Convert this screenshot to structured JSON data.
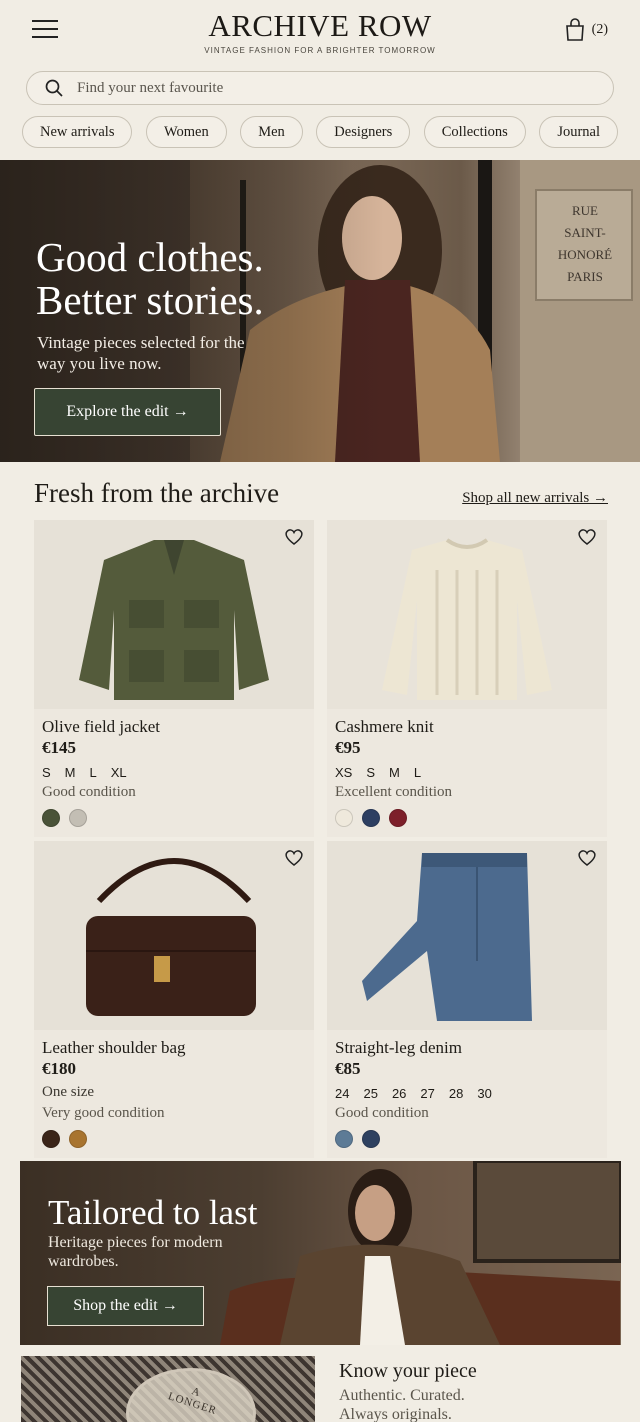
{
  "header": {
    "brand": "ARCHIVE ROW",
    "tagline": "VINTAGE FASHION FOR A BRIGHTER TOMORROW",
    "cart_count": "(2)",
    "icons": {
      "menu": "hamburger-menu-icon",
      "cart": "shopping-bag-icon"
    }
  },
  "search": {
    "placeholder": "Find your next favourite",
    "icon": "search-icon"
  },
  "nav": {
    "chips": [
      "New arrivals",
      "Women",
      "Men",
      "Designers",
      "Collections",
      "Journal"
    ]
  },
  "hero": {
    "title_line1": "Good clothes.",
    "title_line2": "Better stories.",
    "subtitle": "Vintage pieces selected for the way you live now.",
    "button": "Explore the edit →",
    "sign_line1": "RUE",
    "sign_line2": "SAINT-HONORÉ",
    "sign_line3": "PARIS"
  },
  "section": {
    "title": "Fresh from the archive",
    "link": "Shop all new arrivals →"
  },
  "products": [
    {
      "name": "Olive field jacket",
      "price": "€145",
      "sizes": [
        "S",
        "M",
        "L",
        "XL"
      ],
      "condition": "Good condition",
      "swatches": [
        "#4a5338",
        "#c3beb4"
      ]
    },
    {
      "name": "Cashmere knit",
      "price": "€95",
      "sizes": [
        "XS",
        "S",
        "M",
        "L"
      ],
      "condition": "Excellent condition",
      "swatches": [
        "#efe9dc",
        "#2d3f62",
        "#7d1f2a"
      ]
    },
    {
      "name": "Leather shoulder bag",
      "price": "€180",
      "size_text": "One size",
      "condition": "Very good condition",
      "swatches": [
        "#3b2519",
        "#a8742f"
      ]
    },
    {
      "name": "Straight-leg denim",
      "price": "€85",
      "sizes": [
        "24",
        "25",
        "26",
        "27",
        "28",
        "30"
      ],
      "condition": "Good condition",
      "swatches": [
        "#5d7b96",
        "#2e4160"
      ]
    }
  ],
  "promo": {
    "title": "Tailored to last",
    "subtitle": "Heritage pieces for modern wardrobes.",
    "button": "Shop the edit →"
  },
  "know": {
    "title": "Know your piece",
    "sub_line1": "Authentic. Curated.",
    "sub_line2": "Always originals.",
    "label_line1": "A",
    "label_line2": "LONGER"
  },
  "colors": {
    "accent_button": "#374433",
    "background": "#f1ede4"
  }
}
